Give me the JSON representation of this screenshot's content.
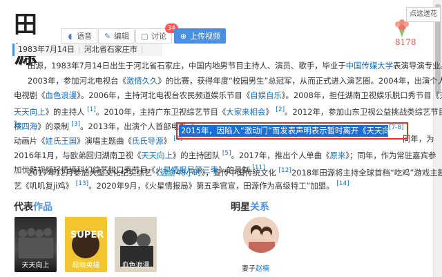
{
  "title": "田源",
  "buttons": {
    "voice": "语音",
    "edit": "编辑",
    "discuss": "讨论",
    "discuss_count": "34",
    "upload": "上传视频"
  },
  "like": {
    "tip": "点这送花",
    "count": "8178"
  },
  "info": {
    "birth": "1983年7月14日",
    "place": "河北省石家庄市",
    "country": "中国"
  },
  "para1": {
    "t1": "田源，1983年7月14日出生于河北省石家庄，中国内地男节目主持人、演员、歌手，毕业于",
    "l1": "中国传媒大学",
    "t2": "表演导演专业。"
  },
  "para2": {
    "line1": "2003年，参加河北电视台《",
    "line1_l": "激情久久",
    "line1_b": "》的比赛，获得年度“校园男生”总冠军，从而正式进入演艺圈。2004年，出演个人首部",
    "line2_a": "电视剧《",
    "line2_l": "血色浪漫",
    "line2_b": "》。2006年，主持河北电视台农民频道娱乐节目《",
    "line2_l2": "自娱自乐",
    "line2_c": "》。2008年，担任湖南卫视娱乐脱口秀节目《",
    "line2_tail": "天",
    "line3_l": "天天向上",
    "line3_a": "》的主持人",
    "ref1": "[1]",
    "line3_b": "。2010年，主持广东卫视综艺节目《",
    "line3_l2": "大家来相会",
    "line3_c": "》",
    "ref2": "[2]",
    "line3_d": "。2012年，参加山东卫视公益挑战类综艺节目《",
    "line3_l3": "纵",
    "line4_l": "横四海",
    "line4_a": "》的录制",
    "ref3": "[3]",
    "line4_b": "。2013年，出演个人首部电影《",
    "line4_tail": "》。",
    "line5_a": "动画片《",
    "line5_l": "娃氏王国",
    "line5_b": "》演唱主题曲《",
    "line5_l2": "氐氏导源",
    "line5_c": "》",
    "ref4": "[6]",
    "line5_tail": "同年，为",
    "line6_a": "2016年1月，与欧弟回归湖南卫视《",
    "line6_l": "天天向上",
    "line6_b": "》的主持团队",
    "ref5": "[5]",
    "line6_c": "。2017年，推出个人单曲《",
    "line6_l2": "原来",
    "line6_d": "》",
    "line6_tail": "；同年，作为常驻嘉宾参",
    "line7_a": "加优酷视频轻情境科幻综艺脱口秀节目《",
    "line7_l": "火星情报局第三季",
    "line7_b": "》的录制",
    "ref6": "[11]"
  },
  "highlight": {
    "text": "2015年，因陷入“激动门”而发表声明表示暂时离开《天天向上》",
    "ref": "[7-8]"
  },
  "para3": {
    "line1_a": "2017年12月参加大型文化纪实综艺《",
    "line1_l": "远游48小时",
    "line1_b": "》，宣传中国传统文化",
    "ref1": "[12]",
    "line1_c": "2018年田源将主持全球首档“吃鸡”游戏主题综",
    "line2_a": "艺《叽叽复ji鸡》",
    "ref2": "[13]",
    "line2_b": "。2020年9月，《火星情报局》第五季官宣，田源作为高级特工”加盟。",
    "ref3": "[14]"
  },
  "works": {
    "title_a": "代表",
    "title_b": "作品",
    "items": [
      "天天向上",
      "超萌英雄",
      "血色浪漫"
    ]
  },
  "relations": {
    "title_a": "明星",
    "title_b": "关系",
    "caption_a": "妻子",
    "caption_b": "赵楠"
  },
  "colors": {
    "accent": "#4a90e2",
    "link": "#136ec2",
    "highlight_border": "#e03030",
    "highlight_fill": "#1a6fd6"
  }
}
